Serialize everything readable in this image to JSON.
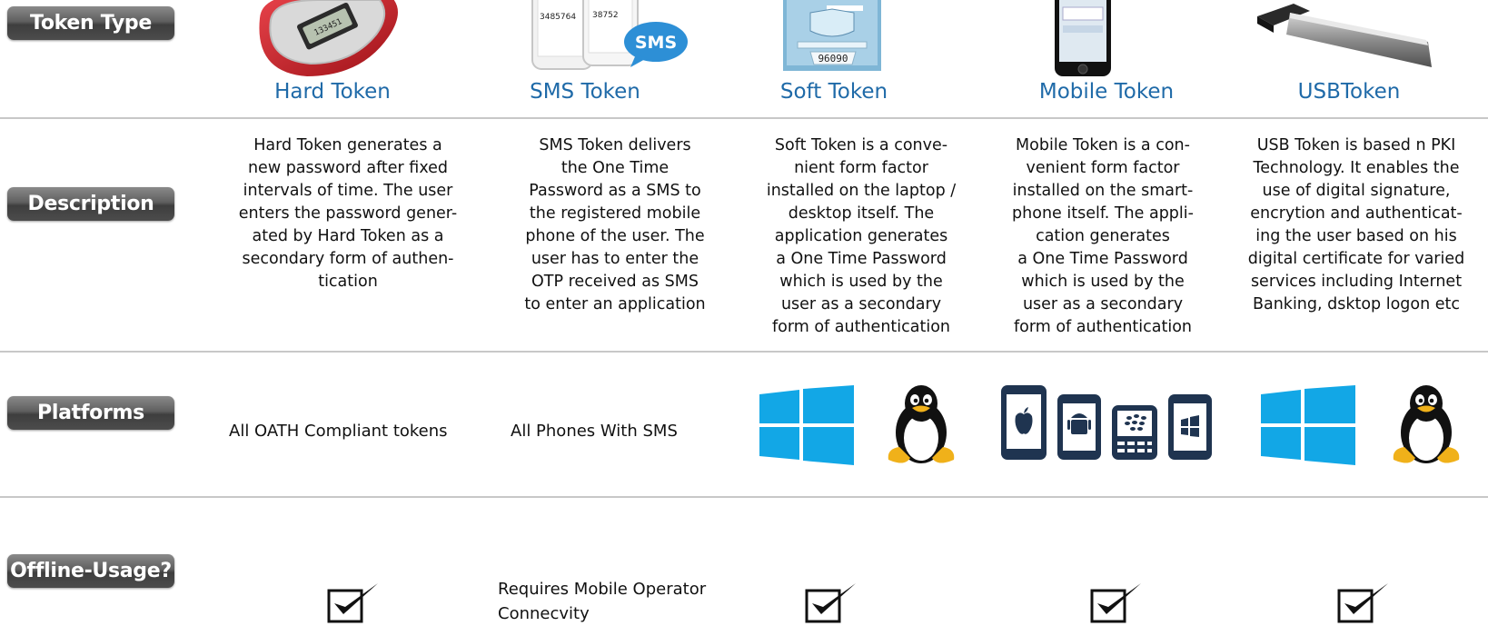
{
  "row_labels": {
    "token_type": "Token Type",
    "description": "Description",
    "platforms": "Platforms",
    "offline": "Offline-Usage?"
  },
  "tokens": [
    {
      "title": "Hard Token",
      "description": [
        "Hard Token generates a",
        "new password after fixed",
        "intervals of time. The user",
        "enters the password gener-",
        "ated by Hard Token as a",
        "secondary form of authen-",
        "tication"
      ],
      "device_text": "133451"
    },
    {
      "title": "SMS Token",
      "description": [
        "SMS Token delivers",
        "the One Time",
        "Password as a SMS to",
        "the registered mobile",
        "phone of the user. The",
        "user has to enter the",
        "OTP received as SMS",
        "to enter an application"
      ],
      "phone_text_1": "3485764",
      "phone_text_2": "38752",
      "badge": "SMS"
    },
    {
      "title": "Soft Token",
      "description": [
        "Soft Token is a conve-",
        "nient form factor",
        "installed on the laptop /",
        "desktop itself. The",
        "application generates",
        "a One Time Password",
        "which is used by the",
        "user as a secondary",
        "form of authentication"
      ],
      "screen_code": "96090"
    },
    {
      "title": "Mobile Token",
      "description": [
        "Mobile Token is a con-",
        "venient form factor",
        "installed on the smart-",
        "phone itself. The appli-",
        "cation generates",
        "a One Time Password",
        "which is used by the",
        "user as a secondary",
        "form of authentication"
      ]
    },
    {
      "title": "USBToken",
      "description": [
        "USB Token is based n PKI",
        "Technology. It enables the",
        "use of digital signature,",
        "encrytion and authenticat-",
        "ing the user based on his",
        "digital certificate for varied",
        "services including Internet",
        "Banking, dsktop logon etc"
      ]
    }
  ],
  "platforms": {
    "hard": "All OATH Compliant tokens",
    "sms": "All Phones With SMS",
    "soft_icons": [
      "windows-logo-icon",
      "linux-penguin-icon"
    ],
    "mobile_icons": [
      "ios-phone-icon",
      "android-phone-icon",
      "blackberry-phone-icon",
      "windows-phone-icon"
    ],
    "usb_icons": [
      "windows-logo-icon",
      "linux-penguin-icon"
    ]
  },
  "offline": {
    "sms_lines": [
      "Requires Mobile Operator",
      "Connecvity"
    ],
    "checked_columns": [
      "Hard Token",
      "Soft Token",
      "Mobile Token",
      "USBToken"
    ]
  },
  "colors": {
    "title_blue": "#1f6aa8",
    "windows_blue": "#12a7e6",
    "phone_navy": "#1f3450",
    "label_gray": "#555555"
  }
}
